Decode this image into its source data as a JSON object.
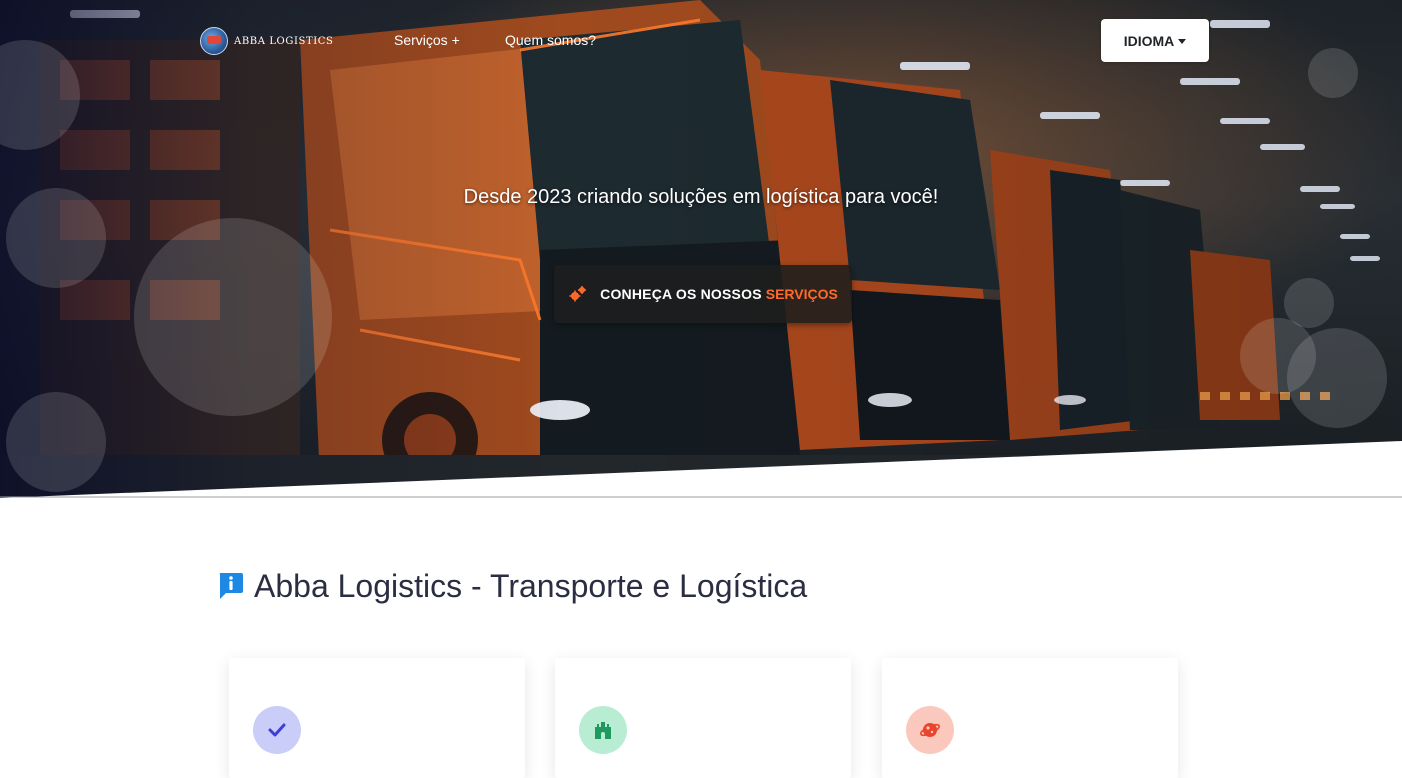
{
  "brand": {
    "name": "ABBA LOGISTICS",
    "logo_icon": "globe-logo-icon"
  },
  "nav": {
    "services_label": "Serviços +",
    "about_label": "Quem somos?",
    "language_label": "IDIOMA"
  },
  "hero": {
    "tagline": "Desde 2023 criando soluções em logística para você!",
    "cta_prefix": "CONHEÇA OS NOSSOS",
    "cta_highlight": "SERVIÇOS",
    "cta_icon": "gears-icon"
  },
  "section": {
    "title": "Abba Logistics - Transporte e Logística",
    "icon": "info-icon"
  },
  "cards": [
    {
      "icon": "check-icon",
      "color": "#c9cdf7",
      "icon_color": "#3b3fd8"
    },
    {
      "icon": "castle-icon",
      "color": "#b8ecd3",
      "icon_color": "#1f9a5e"
    },
    {
      "icon": "planet-icon",
      "color": "#fbc8bd",
      "icon_color": "#e8452c"
    }
  ],
  "colors": {
    "accent": "#ff6a2b",
    "title_text": "#2b2d42",
    "info_icon": "#1e88e5"
  }
}
